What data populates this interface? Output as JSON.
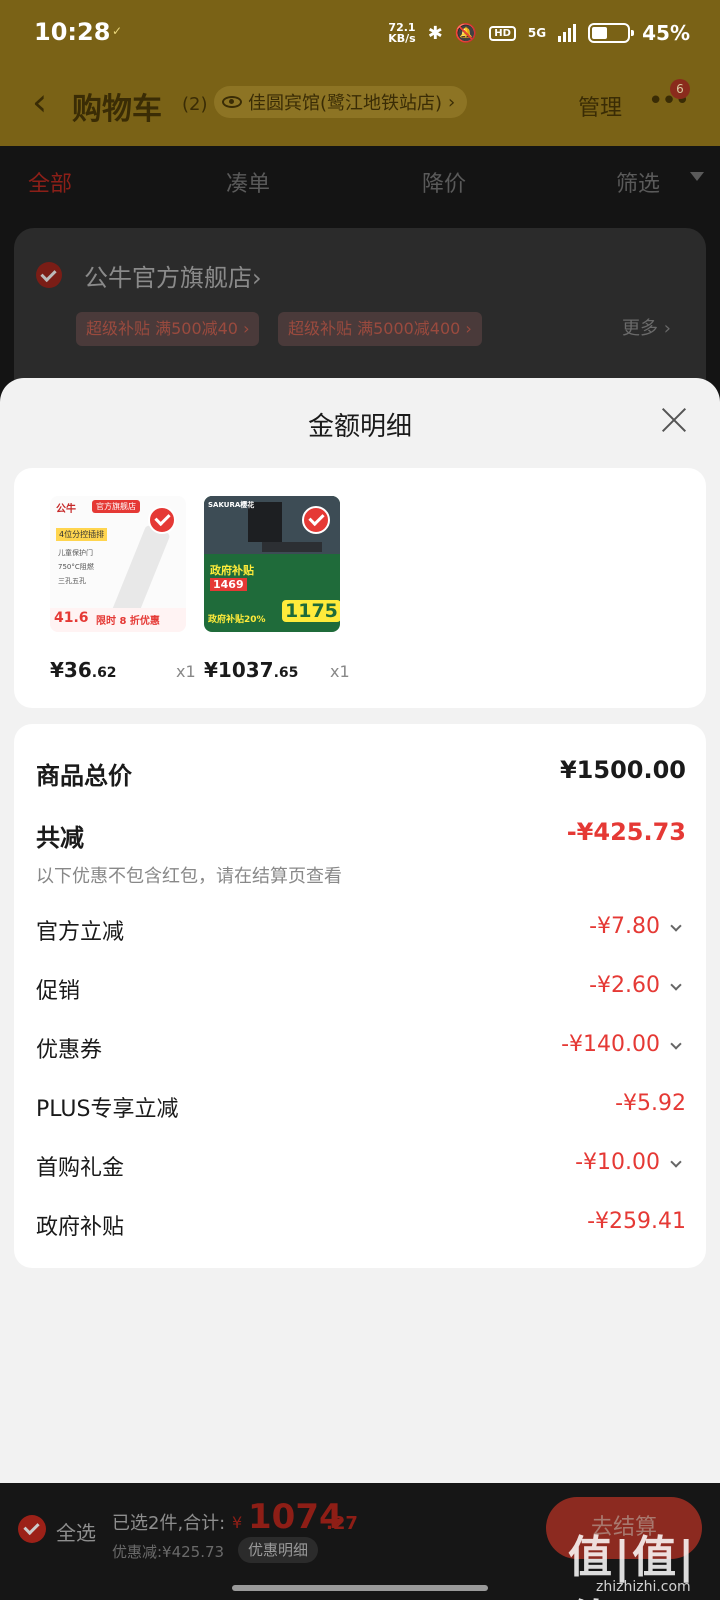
{
  "status_bar": {
    "time": "10:28",
    "location_glyph": "✓",
    "speed": "72.1",
    "speed_unit": "KB/s",
    "bluetooth": "✱",
    "mute": "🔕",
    "hd": "HD",
    "network": "5G",
    "battery_percent": "45%",
    "battery_level": 0.45
  },
  "nav": {
    "back_icon": "chevron-left-icon",
    "title": "购物车",
    "count": "(2)",
    "address": "佳圆宾馆(鹭江地铁站店)",
    "address_chevron": "›",
    "manage": "管理",
    "more": "•••",
    "badge": "6"
  },
  "tabs": [
    {
      "label": "全部",
      "active": true
    },
    {
      "label": "凑单",
      "active": false
    },
    {
      "label": "降价",
      "active": false
    },
    {
      "label": "筛选",
      "active": false
    }
  ],
  "store": {
    "name": "公牛官方旗舰店",
    "chevron": "›",
    "promos": [
      "超级补贴 满500减40 ›",
      "超级补贴 满5000减400 ›"
    ],
    "more": "更多 ›"
  },
  "sheet": {
    "title": "金额明细",
    "close_icon": "close-icon"
  },
  "goods": [
    {
      "price_int": "¥36",
      "price_dec": ".62",
      "qty": "x1",
      "thumb": {
        "logo": "公牛",
        "flag": "官方旗舰店",
        "bar": "4位分控插排",
        "lines": [
          "儿童保护门",
          "750°C阻燃",
          "三孔五孔"
        ],
        "sale_price": "41.6",
        "sale_label": "限时 8 折优惠"
      }
    },
    {
      "price_int": "¥1037",
      "price_dec": ".65",
      "qty": "x1",
      "thumb": {
        "brand": "SAKURA樱花",
        "yellow": "政府补贴",
        "price_a": "1469",
        "gov": "政府补贴20%",
        "price_b": "1175"
      }
    }
  ],
  "summary": {
    "total_label": "商品总价",
    "total_value": "¥1500.00",
    "discount_label": "共减",
    "discount_value": "-¥425.73",
    "note": "以下优惠不包含红包，请在结算页查看",
    "items": [
      {
        "label": "官方立减",
        "value": "-¥7.80",
        "expandable": true
      },
      {
        "label": "促销",
        "value": "-¥2.60",
        "expandable": true
      },
      {
        "label": "优惠券",
        "value": "-¥140.00",
        "expandable": true
      },
      {
        "label": "PLUS专享立减",
        "value": "-¥5.92",
        "expandable": false
      },
      {
        "label": "首购礼金",
        "value": "-¥10.00",
        "expandable": true
      },
      {
        "label": "政府补贴",
        "value": "-¥259.41",
        "expandable": false
      }
    ]
  },
  "bottom": {
    "select_all": "全选",
    "selected_text": "已选2件,合计:",
    "currency": "¥",
    "total_int": "1074",
    "total_dec": ".27",
    "discount_text": "优惠减:¥425.73",
    "detail_button": "优惠明细",
    "checkout": "去结算",
    "watermark": "值|值|值",
    "watermark_url": "zhizhizhi.com"
  },
  "colors": {
    "accent": "#e53935",
    "header_dim": "#7a6216",
    "sheet_bg": "#f2f2f2"
  }
}
